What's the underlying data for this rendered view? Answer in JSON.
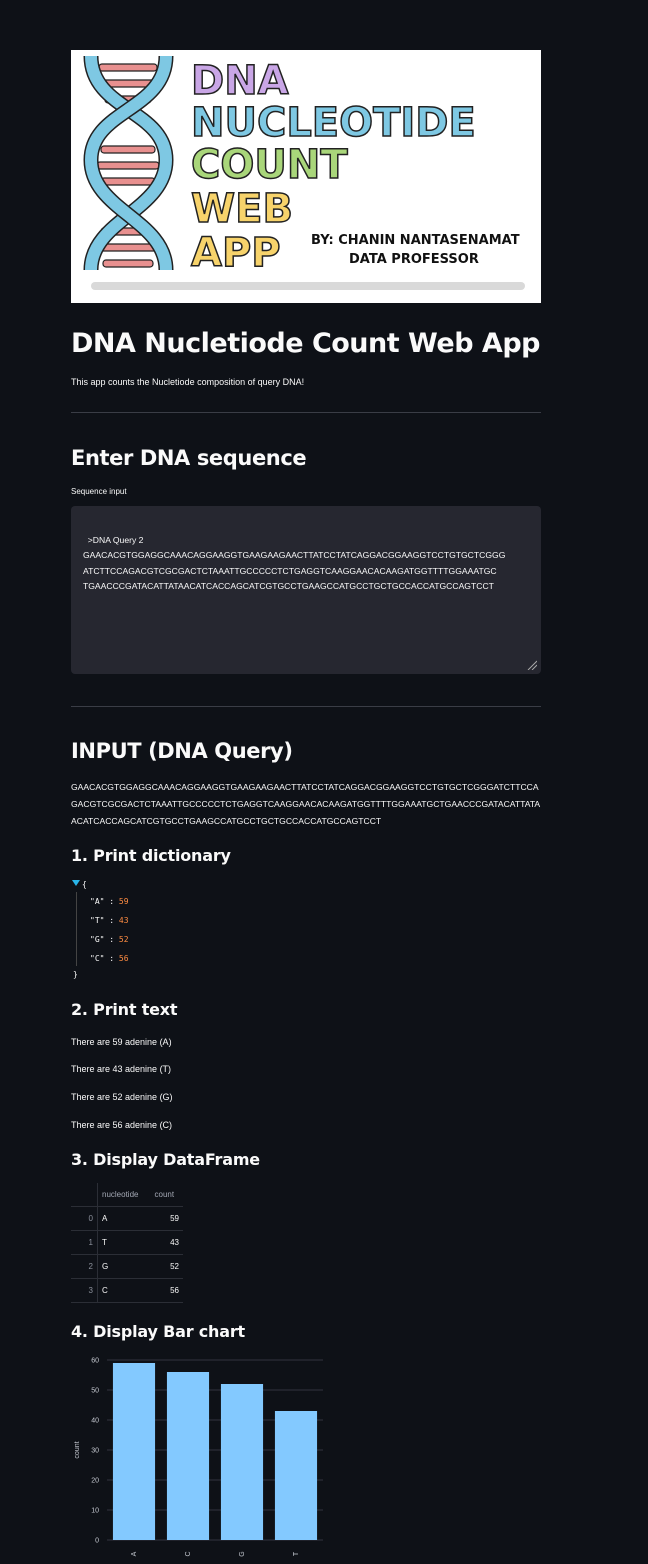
{
  "banner": {
    "title_lines": [
      "DNA",
      "NUCLEOTIDE",
      "COUNT",
      "WEB",
      "APP"
    ],
    "byline": [
      "BY: CHANIN NANTASENAMAT",
      "DATA PROFESSOR"
    ]
  },
  "app": {
    "title": "DNA Nucletiode Count Web App",
    "description": "This app counts the Nucletiode composition of query DNA!"
  },
  "enter_section": {
    "heading": "Enter DNA sequence",
    "input_label": "Sequence input",
    "input_value": ">DNA Query 2\nGAACACGTGGAGGCAAACAGGAAGGTGAAGAAGAACTTATCCTATCAGGACGGAAGGTCCTGTGCTCGGG\nATCTTCCAGACGTCGCGACTCTAAATTGCCCCCTCTGAGGTCAAGGAACACAAGATGGTTTTGGAAATGC\nTGAACCCGATACATTATAACATCACCAGCATCGTGCCTGAAGCCATGCCTGCTGCCACCATGCCAGTCCT"
  },
  "input_section": {
    "heading": "INPUT (DNA Query)",
    "sequence_lines": [
      "GAACACGTGGAGGCAAACAGGAAGGTGAAGAAGAACTTATCCTATCAGGACGGAAGGTCCTGTGCTCGGGATCTTCCA",
      "GACGTCGCGACTCTAAATTGCCCCCTCTGAGGTCAAGGAACACAAGATGGTTTTGGAAATGCTGAACCCGATACATTATA",
      "ACATCACCAGCATCGTGCCTGAAGCCATGCCTGCTGCCACCATGCCAGTCCT"
    ]
  },
  "dict_section": {
    "heading": "1. Print dictionary",
    "open_brace": "{",
    "close_brace": "}",
    "entries": [
      {
        "key": "\"A\"",
        "sep": " : ",
        "value": "59"
      },
      {
        "key": "\"T\"",
        "sep": " : ",
        "value": "43"
      },
      {
        "key": "\"G\"",
        "sep": " : ",
        "value": "52"
      },
      {
        "key": "\"C\"",
        "sep": " : ",
        "value": "56"
      }
    ]
  },
  "text_section": {
    "heading": "2. Print text",
    "lines": [
      "There are 59 adenine (A)",
      "There are 43 adenine (T)",
      "There are 52 adenine (G)",
      "There are 56 adenine (C)"
    ]
  },
  "df_section": {
    "heading": "3. Display DataFrame",
    "columns": [
      "nucleotide",
      "count"
    ],
    "rows": [
      {
        "index": "0",
        "nucleotide": "A",
        "count": "59"
      },
      {
        "index": "1",
        "nucleotide": "T",
        "count": "43"
      },
      {
        "index": "2",
        "nucleotide": "G",
        "count": "52"
      },
      {
        "index": "3",
        "nucleotide": "C",
        "count": "56"
      }
    ]
  },
  "bar_section": {
    "heading": "4. Display Bar chart"
  },
  "colors": {
    "background": "#0e1117",
    "widget": "#262730",
    "bar": "#83c9ff",
    "number": "#ff8c42"
  },
  "chart_data": {
    "type": "bar",
    "categories": [
      "A",
      "C",
      "G",
      "T"
    ],
    "values": [
      59,
      56,
      52,
      43
    ],
    "ylabel": "count",
    "xlabel": "",
    "ylim": [
      0,
      60
    ],
    "yticks": [
      0,
      10,
      20,
      30,
      40,
      50,
      60
    ],
    "grid": true
  }
}
